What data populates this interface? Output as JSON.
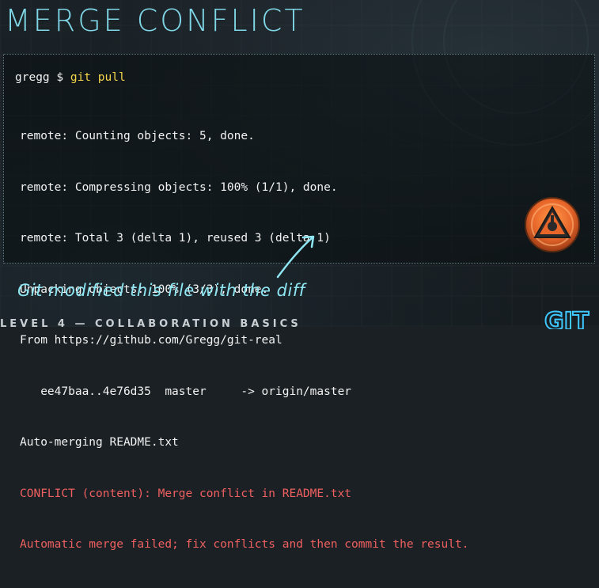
{
  "slide": {
    "title": "MERGE CONFLICT",
    "footer": "LEVEL 4 — COLLABORATION BASICS",
    "logo_text": "GIT"
  },
  "terminal": {
    "prompt": "gregg $ ",
    "command": "git pull",
    "lines": [
      "remote: Counting objects: 5, done.",
      "remote: Compressing objects: 100% (1/1), done.",
      "remote: Total 3 (delta 1), reused 3 (delta 1)",
      "Unpacking objects: 100% (3/3), done.",
      "From https://github.com/Gregg/git-real",
      "   ee47baa..4e76d35  master     -> origin/master",
      "Auto-merging README.txt"
    ],
    "conflict_lines": [
      "CONFLICT (content): Merge conflict in README.txt",
      "Automatic merge failed; fix conflicts and then commit the result."
    ]
  },
  "annotation": {
    "text": "Git modified this file with the diff"
  },
  "icons": {
    "alert": "warning-alert-icon",
    "arrow": "annotation-arrow-icon"
  },
  "colors": {
    "title": "#7fd6e6",
    "command": "#f2d34a",
    "conflict": "#f06060",
    "annotation": "#8ee6f2",
    "alert": "#e8662a"
  }
}
